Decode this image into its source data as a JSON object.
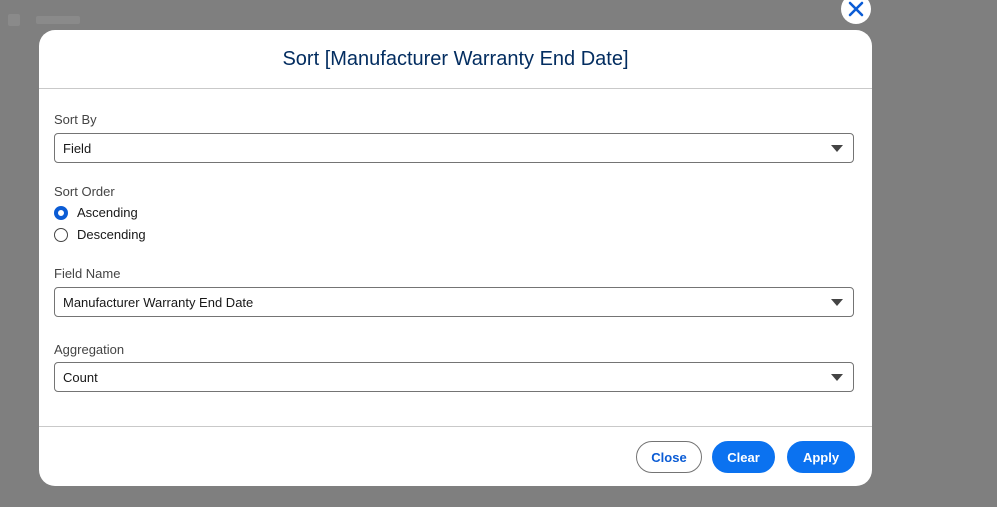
{
  "modal": {
    "title": "Sort [Manufacturer Warranty End Date]",
    "sort_by": {
      "label": "Sort By",
      "value": "Field"
    },
    "sort_order": {
      "label": "Sort Order",
      "options": [
        {
          "label": "Ascending",
          "checked": true
        },
        {
          "label": "Descending",
          "checked": false
        }
      ]
    },
    "field_name": {
      "label": "Field Name",
      "value": "Manufacturer Warranty End Date"
    },
    "aggregation": {
      "label": "Aggregation",
      "value": "Count"
    },
    "buttons": {
      "close": "Close",
      "clear": "Clear",
      "apply": "Apply"
    }
  },
  "icons": {
    "dismiss": "close-icon",
    "dropdown": "chevron-down-icon"
  },
  "colors": {
    "accent": "#0b72f0",
    "title": "#032d60",
    "overlay": "#7f7f7f"
  }
}
